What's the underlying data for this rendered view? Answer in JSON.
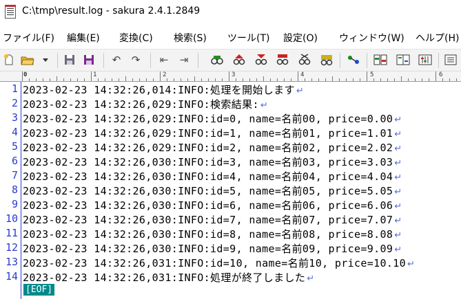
{
  "window": {
    "title": "C:\\tmp\\result.log - sakura 2.4.1.2849"
  },
  "menu": [
    "ファイル(F)",
    "編集(E)",
    "変換(C)",
    "検索(S)",
    "ツール(T)",
    "設定(O)",
    "ウィンドウ(W)",
    "ヘルプ(H)"
  ],
  "toolbar": {
    "icons": [
      "new-file-icon",
      "open-folder-icon",
      "dropdown-arrow-icon",
      "save-icon",
      "save-all-icon",
      "undo-icon",
      "redo-icon",
      "jump-back-icon",
      "jump-forward-icon",
      "search-icon",
      "search-prev-icon",
      "search-next-icon",
      "grep-icon",
      "replace-icon",
      "outline-icon",
      "tag-jump-icon",
      "compare-icon",
      "split-view-icon",
      "settings-icon",
      "more-icon"
    ]
  },
  "ruler": {
    "labels": [
      "0",
      "1",
      "2",
      "3",
      "4",
      "5",
      "6"
    ]
  },
  "editor": {
    "lines": [
      {
        "no": "1",
        "text": "2023-02-23 14:32:26,014:INFO:処理を開始します"
      },
      {
        "no": "2",
        "text": "2023-02-23 14:32:26,029:INFO:検索結果:"
      },
      {
        "no": "3",
        "text": "2023-02-23 14:32:26,029:INFO:id=0, name=名前00, price=0.00"
      },
      {
        "no": "4",
        "text": "2023-02-23 14:32:26,029:INFO:id=1, name=名前01, price=1.01"
      },
      {
        "no": "5",
        "text": "2023-02-23 14:32:26,029:INFO:id=2, name=名前02, price=2.02"
      },
      {
        "no": "6",
        "text": "2023-02-23 14:32:26,030:INFO:id=3, name=名前03, price=3.03"
      },
      {
        "no": "7",
        "text": "2023-02-23 14:32:26,030:INFO:id=4, name=名前04, price=4.04"
      },
      {
        "no": "8",
        "text": "2023-02-23 14:32:26,030:INFO:id=5, name=名前05, price=5.05"
      },
      {
        "no": "9",
        "text": "2023-02-23 14:32:26,030:INFO:id=6, name=名前06, price=6.06"
      },
      {
        "no": "10",
        "text": "2023-02-23 14:32:26,030:INFO:id=7, name=名前07, price=7.07"
      },
      {
        "no": "11",
        "text": "2023-02-23 14:32:26,030:INFO:id=8, name=名前08, price=8.08"
      },
      {
        "no": "12",
        "text": "2023-02-23 14:32:26,030:INFO:id=9, name=名前09, price=9.09"
      },
      {
        "no": "13",
        "text": "2023-02-23 14:32:26,031:INFO:id=10, name=名前10, price=10.10"
      },
      {
        "no": "14",
        "text": "2023-02-23 14:32:26,031:INFO:処理が終了しました"
      }
    ],
    "newline_glyph": "↵",
    "eof_label": "[EOF]"
  },
  "colors": {
    "line_number": "#2a3bd0",
    "eof_bg": "#008a8a",
    "newline": "#5a6bd8"
  }
}
